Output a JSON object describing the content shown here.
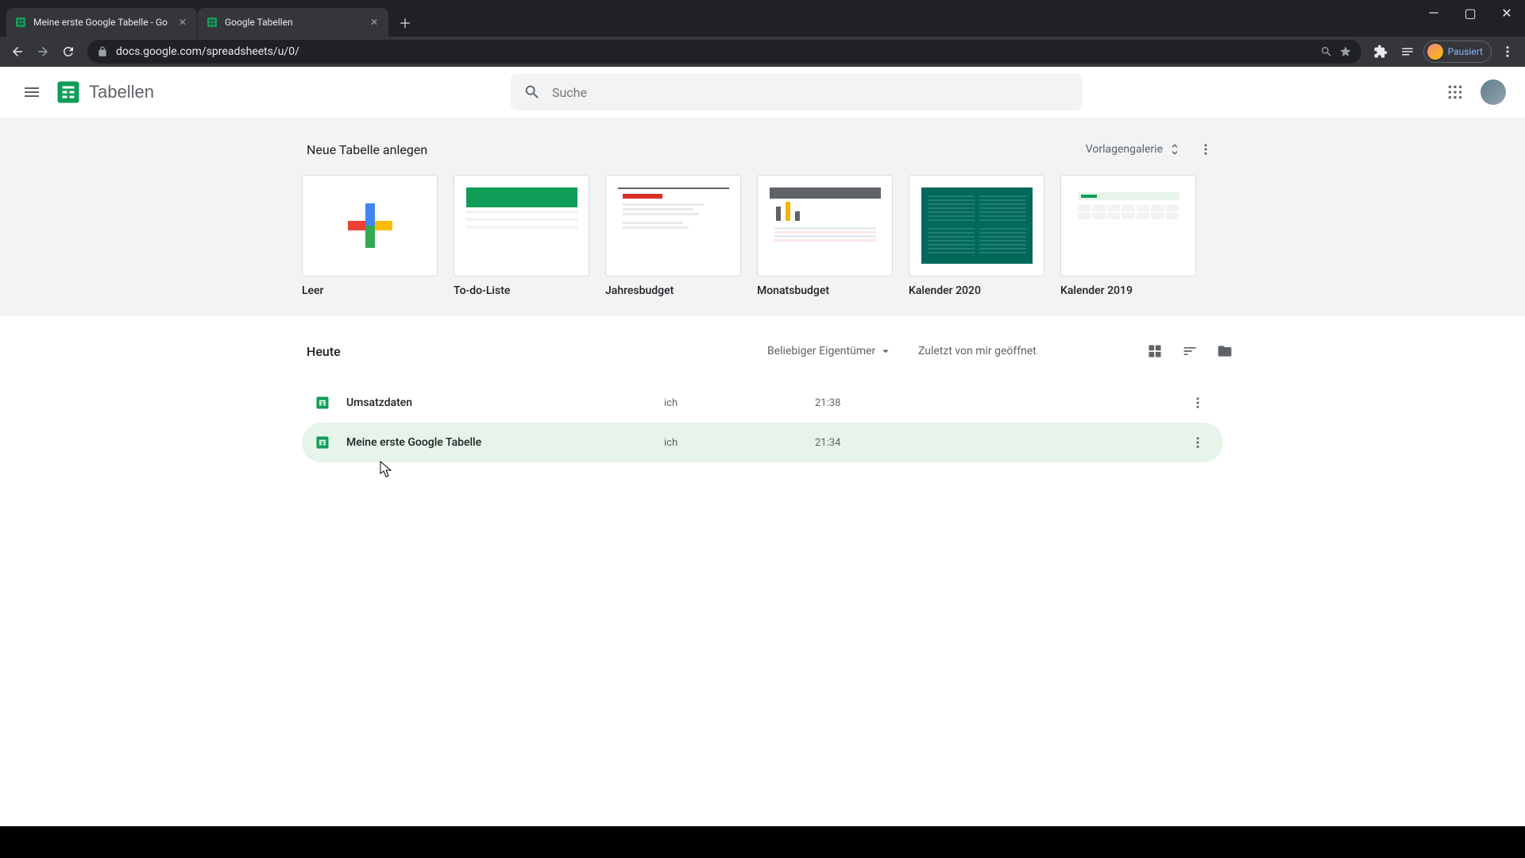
{
  "browser": {
    "tabs": [
      {
        "title": "Meine erste Google Tabelle - Go"
      },
      {
        "title": "Google Tabellen"
      }
    ],
    "url": "docs.google.com/spreadsheets/u/0/",
    "profile_label": "Pausiert"
  },
  "header": {
    "app_name": "Tabellen",
    "search_placeholder": "Suche"
  },
  "templates": {
    "heading": "Neue Tabelle anlegen",
    "gallery_label": "Vorlagengalerie",
    "items": [
      {
        "label": "Leer"
      },
      {
        "label": "To-do-Liste"
      },
      {
        "label": "Jahresbudget"
      },
      {
        "label": "Monatsbudget"
      },
      {
        "label": "Kalender 2020"
      },
      {
        "label": "Kalender 2019"
      }
    ]
  },
  "docs": {
    "section_title": "Heute",
    "owner_filter": "Beliebiger Eigentümer",
    "sort_label": "Zuletzt von mir geöffnet",
    "rows": [
      {
        "name": "Umsatzdaten",
        "owner": "ich",
        "time": "21:38"
      },
      {
        "name": "Meine erste Google Tabelle",
        "owner": "ich",
        "time": "21:34"
      }
    ]
  }
}
